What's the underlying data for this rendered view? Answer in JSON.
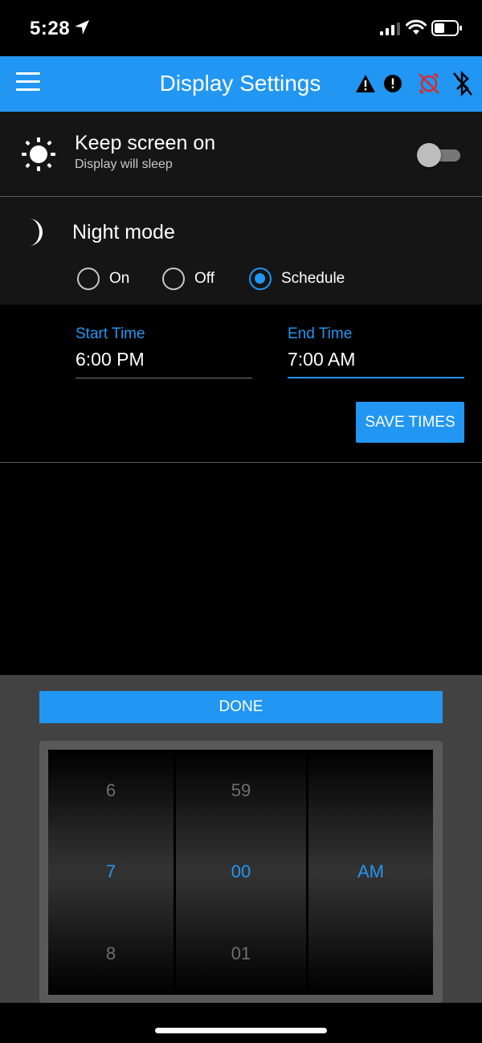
{
  "status_bar": {
    "time": "5:28",
    "icons": [
      "location-arrow-icon",
      "signal-icon",
      "wifi-icon",
      "battery-icon"
    ]
  },
  "app_bar": {
    "title": "Display Settings",
    "color": "#2196f3",
    "icons": [
      "menu-icon",
      "warning-icon",
      "alert-icon",
      "sync-disabled-icon",
      "bluetooth-disabled-icon"
    ]
  },
  "keep_screen": {
    "title": "Keep screen on",
    "subtitle": "Display will sleep",
    "enabled": false,
    "icon": "sun-icon"
  },
  "night_mode": {
    "title": "Night mode",
    "icon": "moon-icon",
    "options": [
      {
        "label": "On",
        "checked": false
      },
      {
        "label": "Off",
        "checked": false
      },
      {
        "label": "Schedule",
        "checked": true
      }
    ]
  },
  "schedule": {
    "start_label": "Start Time",
    "start_value": "6:00 PM",
    "end_label": "End Time",
    "end_value": "7:00 AM",
    "save_label": "SAVE TIMES"
  },
  "picker": {
    "done_label": "DONE",
    "hours": {
      "prev": "6",
      "selected": "7",
      "next": "8"
    },
    "minutes": {
      "prev": "59",
      "selected": "00",
      "next": "01"
    },
    "period": {
      "selected": "AM"
    }
  }
}
